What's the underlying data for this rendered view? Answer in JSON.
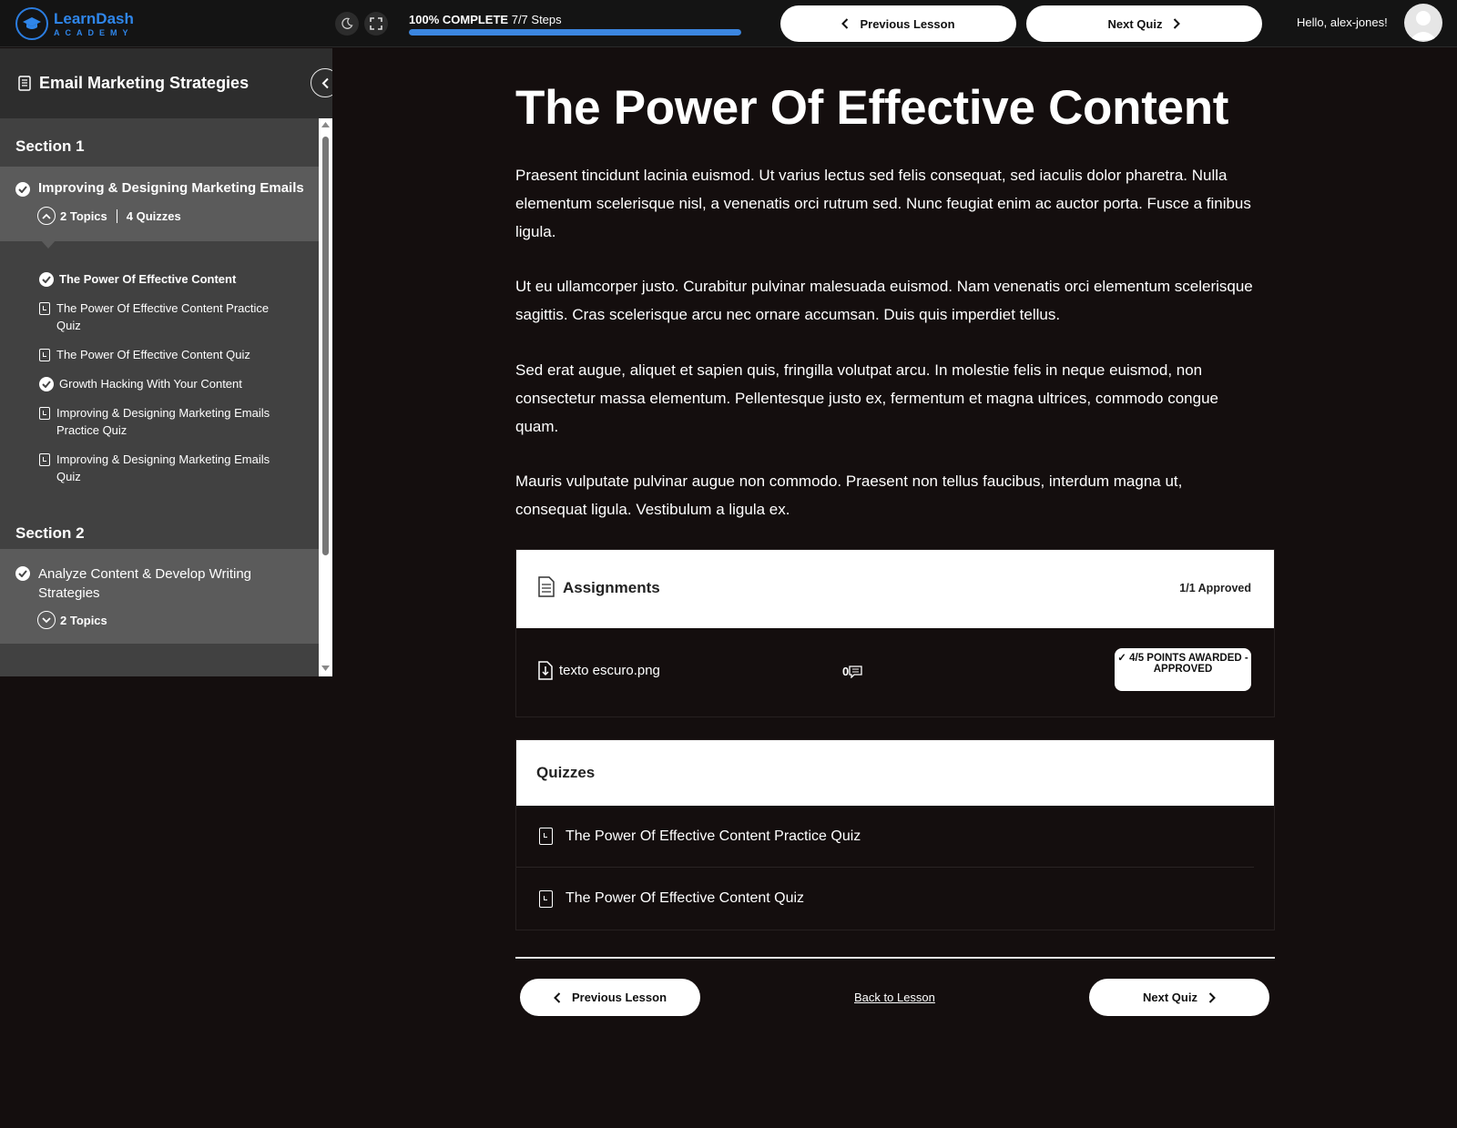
{
  "brand": {
    "name": "LearnDash",
    "sub": "ACADEMY",
    "color": "#2f86ea"
  },
  "header": {
    "dark_mode_icon": "moon-icon",
    "fullscreen_icon": "expand-icon",
    "progress": {
      "label": "100% COMPLETE",
      "steps": "7/7 Steps",
      "fraction": 1.0
    },
    "prev_label": "Previous Lesson",
    "next_label": "Next Quiz",
    "greeting": "Hello, alex-jones!"
  },
  "sidebar": {
    "course_title": "Email Marketing Strategies",
    "sections": [
      {
        "title": "Section 1",
        "lesson": {
          "title": "Improving & Designing Marketing Emails",
          "topics_count": "2 Topics",
          "quizzes_count": "4 Quizzes",
          "items": [
            {
              "label": "The Power Of Effective Content",
              "type": "topic",
              "current": true
            },
            {
              "label": "The Power Of Effective Content Practice Quiz",
              "type": "quiz"
            },
            {
              "label": "The Power Of Effective Content Quiz",
              "type": "quiz"
            },
            {
              "label": "Growth Hacking With Your Content",
              "type": "topic"
            },
            {
              "label": "Improving & Designing Marketing Emails Practice Quiz",
              "type": "quiz"
            },
            {
              "label": "Improving & Designing Marketing Emails Quiz",
              "type": "quiz"
            }
          ]
        }
      },
      {
        "title": "Section 2",
        "lesson": {
          "title": "Analyze Content & Develop Writing Strategies",
          "topics_count": "2 Topics"
        }
      }
    ]
  },
  "main": {
    "title": "The Power Of Effective Content",
    "paragraphs": [
      "Praesent tincidunt lacinia euismod. Ut varius lectus sed felis consequat, sed iaculis dolor pharetra. Nulla elementum scelerisque nisl, a venenatis orci rutrum sed. Nunc feugiat enim ac auctor porta. Fusce a finibus ligula.",
      "Ut eu ullamcorper justo. Curabitur pulvinar malesuada euismod. Nam venenatis orci elementum scelerisque sagittis. Cras scelerisque arcu nec ornare accumsan. Duis quis imperdiet tellus.",
      "Sed erat augue, aliquet et sapien quis, fringilla volutpat arcu. In molestie felis in neque euismod, non consectetur massa elementum. Pellentesque justo ex, fermentum et magna ultrices, commodo congue quam.",
      "Mauris vulputate pulvinar augue non commodo. Praesent non tellus faucibus, interdum magna ut, consequat ligula. Vestibulum a ligula ex."
    ],
    "assignments": {
      "title": "Assignments",
      "status": "1/1 Approved",
      "file": "texto escuro.png",
      "comments": "0",
      "badge": "✓ 4/5 POINTS AWARDED - APPROVED"
    },
    "quizzes": {
      "title": "Quizzes",
      "items": [
        "The Power Of Effective Content Practice Quiz",
        "The Power Of Effective Content Quiz"
      ]
    },
    "footer": {
      "prev_label": "Previous Lesson",
      "back_label": "Back to Lesson",
      "next_label": "Next Quiz"
    }
  }
}
